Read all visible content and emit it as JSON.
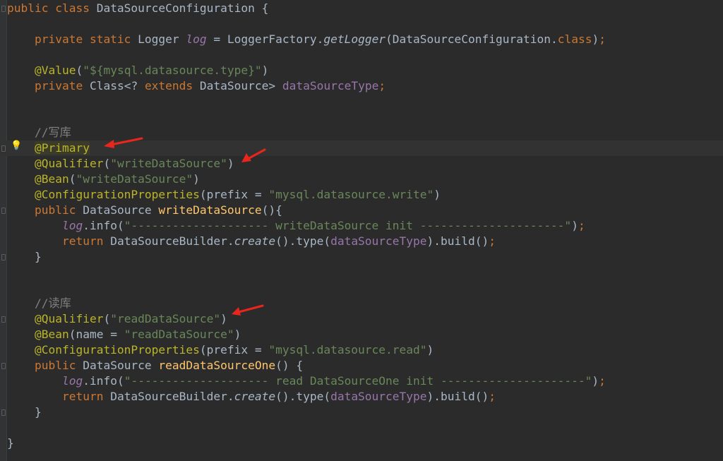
{
  "editor": {
    "lines": [
      [
        {
          "t": "public class",
          "c": "kw"
        },
        {
          "t": " DataSourceConfiguration {",
          "c": ""
        }
      ],
      [],
      [
        {
          "t": "    ",
          "c": ""
        },
        {
          "t": "private static",
          "c": "kw"
        },
        {
          "t": " Logger ",
          "c": ""
        },
        {
          "t": "log",
          "c": "ifld"
        },
        {
          "t": " = LoggerFactory.",
          "c": ""
        },
        {
          "t": "getLogger",
          "c": "it"
        },
        {
          "t": "(DataSourceConfiguration.",
          "c": ""
        },
        {
          "t": "class",
          "c": "kw"
        },
        {
          "t": ")",
          "c": ""
        },
        {
          "t": ";",
          "c": "kw"
        }
      ],
      [],
      [
        {
          "t": "    ",
          "c": ""
        },
        {
          "t": "@Value",
          "c": "ann"
        },
        {
          "t": "(",
          "c": ""
        },
        {
          "t": "\"${mysql.datasource.type}\"",
          "c": "str"
        },
        {
          "t": ")",
          "c": ""
        }
      ],
      [
        {
          "t": "    ",
          "c": ""
        },
        {
          "t": "private",
          "c": "kw"
        },
        {
          "t": " Class<? ",
          "c": ""
        },
        {
          "t": "extends",
          "c": "kw"
        },
        {
          "t": " DataSource> ",
          "c": ""
        },
        {
          "t": "dataSourceType",
          "c": "fld"
        },
        {
          "t": ";",
          "c": "kw"
        }
      ],
      [],
      [],
      [
        {
          "t": "    //写库",
          "c": "cmt"
        }
      ],
      [
        {
          "t": "    ",
          "c": ""
        },
        {
          "t": "@Primary",
          "c": "ann primary-hl"
        }
      ],
      [
        {
          "t": "    ",
          "c": ""
        },
        {
          "t": "@Qualifier",
          "c": "ann"
        },
        {
          "t": "(",
          "c": ""
        },
        {
          "t": "\"writeDataSource\"",
          "c": "str"
        },
        {
          "t": ")",
          "c": ""
        }
      ],
      [
        {
          "t": "    ",
          "c": ""
        },
        {
          "t": "@Bean",
          "c": "ann"
        },
        {
          "t": "(",
          "c": ""
        },
        {
          "t": "\"writeDataSource\"",
          "c": "str"
        },
        {
          "t": ")",
          "c": ""
        }
      ],
      [
        {
          "t": "    ",
          "c": ""
        },
        {
          "t": "@ConfigurationProperties",
          "c": "ann"
        },
        {
          "t": "(prefix = ",
          "c": ""
        },
        {
          "t": "\"mysql.datasource.write\"",
          "c": "str"
        },
        {
          "t": ")",
          "c": ""
        }
      ],
      [
        {
          "t": "    ",
          "c": ""
        },
        {
          "t": "public",
          "c": "kw"
        },
        {
          "t": " DataSource ",
          "c": ""
        },
        {
          "t": "writeDataSource",
          "c": "fn"
        },
        {
          "t": "(){",
          "c": ""
        }
      ],
      [
        {
          "t": "        ",
          "c": ""
        },
        {
          "t": "log",
          "c": "ifld"
        },
        {
          "t": ".info(",
          "c": ""
        },
        {
          "t": "\"-------------------- writeDataSource init ---------------------\"",
          "c": "str"
        },
        {
          "t": ")",
          "c": ""
        },
        {
          "t": ";",
          "c": "kw"
        }
      ],
      [
        {
          "t": "        ",
          "c": ""
        },
        {
          "t": "return",
          "c": "kw"
        },
        {
          "t": " DataSourceBuilder.",
          "c": ""
        },
        {
          "t": "create",
          "c": "it"
        },
        {
          "t": "().type(",
          "c": ""
        },
        {
          "t": "dataSourceType",
          "c": "fld"
        },
        {
          "t": ").build()",
          "c": ""
        },
        {
          "t": ";",
          "c": "kw"
        }
      ],
      [
        {
          "t": "    }",
          "c": ""
        }
      ],
      [],
      [],
      [
        {
          "t": "    //读库",
          "c": "cmt"
        }
      ],
      [
        {
          "t": "    ",
          "c": ""
        },
        {
          "t": "@Qualifier",
          "c": "ann"
        },
        {
          "t": "(",
          "c": ""
        },
        {
          "t": "\"readDataSource\"",
          "c": "str"
        },
        {
          "t": ")",
          "c": ""
        }
      ],
      [
        {
          "t": "    ",
          "c": ""
        },
        {
          "t": "@Bean",
          "c": "ann"
        },
        {
          "t": "(name = ",
          "c": ""
        },
        {
          "t": "\"readDataSource\"",
          "c": "str"
        },
        {
          "t": ")",
          "c": ""
        }
      ],
      [
        {
          "t": "    ",
          "c": ""
        },
        {
          "t": "@ConfigurationProperties",
          "c": "ann"
        },
        {
          "t": "(prefix = ",
          "c": ""
        },
        {
          "t": "\"mysql.datasource.read\"",
          "c": "str"
        },
        {
          "t": ")",
          "c": ""
        }
      ],
      [
        {
          "t": "    ",
          "c": ""
        },
        {
          "t": "public",
          "c": "kw"
        },
        {
          "t": " DataSource ",
          "c": ""
        },
        {
          "t": "readDataSourceOne",
          "c": "fn"
        },
        {
          "t": "() {",
          "c": ""
        }
      ],
      [
        {
          "t": "        ",
          "c": ""
        },
        {
          "t": "log",
          "c": "ifld"
        },
        {
          "t": ".info(",
          "c": ""
        },
        {
          "t": "\"-------------------- read DataSourceOne init ---------------------\"",
          "c": "str"
        },
        {
          "t": ")",
          "c": ""
        },
        {
          "t": ";",
          "c": "kw"
        }
      ],
      [
        {
          "t": "        ",
          "c": ""
        },
        {
          "t": "return",
          "c": "kw"
        },
        {
          "t": " DataSourceBuilder.",
          "c": ""
        },
        {
          "t": "create",
          "c": "it"
        },
        {
          "t": "().type(",
          "c": ""
        },
        {
          "t": "dataSourceType",
          "c": "fld"
        },
        {
          "t": ").build()",
          "c": ""
        },
        {
          "t": ";",
          "c": "kw"
        }
      ],
      [
        {
          "t": "    }",
          "c": ""
        }
      ],
      [],
      [
        {
          "t": "}",
          "c": ""
        }
      ]
    ],
    "current_line": 9,
    "fold_lines": [
      0,
      9,
      13,
      16,
      20,
      23,
      26
    ],
    "bulb_icon": "lightbulb-icon",
    "arrow_color": "#e8261c",
    "arrow_targets": [
      "@Primary",
      "@Qualifier(\"writeDataSource\")",
      "@Qualifier(\"readDataSource\")"
    ]
  }
}
